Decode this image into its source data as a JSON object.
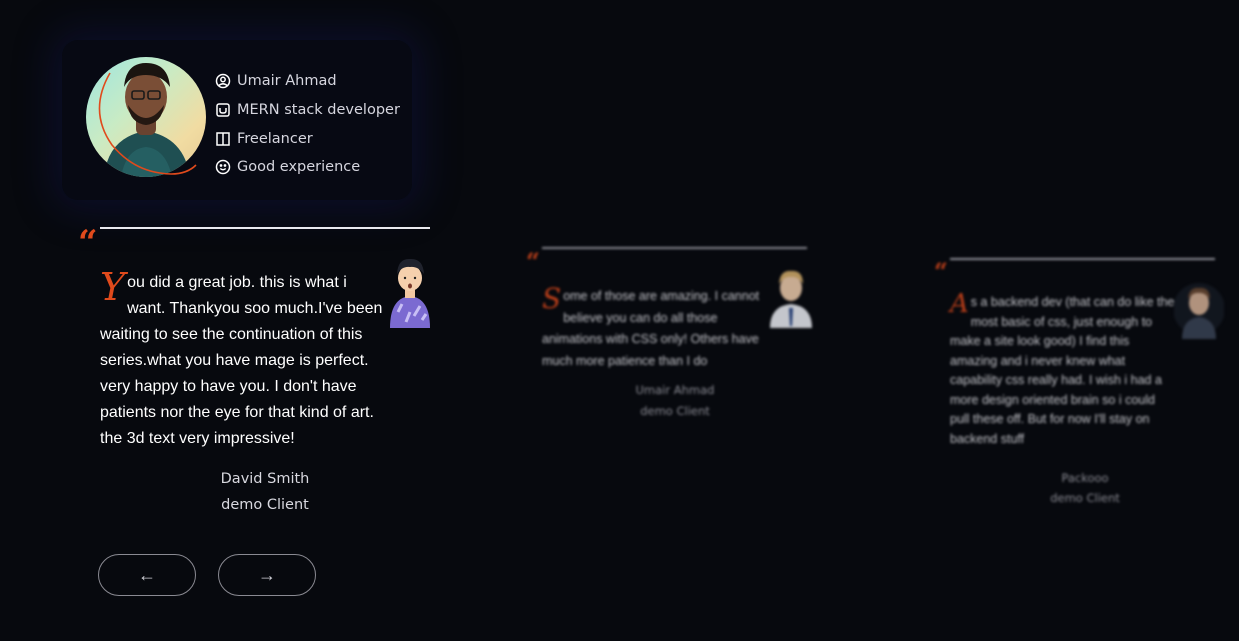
{
  "profile": {
    "name": "Umair Ahmad",
    "role": "MERN stack developer",
    "work": "Freelancer",
    "experience": "Good experience",
    "icons": [
      "user-circle-icon",
      "code-icon",
      "columns-icon",
      "smile-icon"
    ]
  },
  "testimonials": [
    {
      "dropcap": "Y",
      "text": "ou did a great job. this is what i want. Thankyou soo much.I've been waiting to see the continuation of this series.what you have mage is perfect. very happy to have you. I don't have patients nor the eye for that kind of art. the 3d text very impressive!",
      "name": "David Smith",
      "role": "demo Client"
    },
    {
      "dropcap": "S",
      "text": "ome of those are amazing. I cannot believe you can do all those animations with CSS only! Others have much more patience than I do",
      "name": "Umair Ahmad",
      "role": "demo Client"
    },
    {
      "dropcap": "A",
      "text": "s a backend dev (that can do like the most basic of css, just enough to make a site look good) I find this amazing and i never knew what capability css really had. I wish i had a more design oriented brain so i could pull these off. But for now I'll stay on backend stuff",
      "name": "Packooo",
      "role": "demo Client"
    }
  ],
  "nav": {
    "prev": "←",
    "next": "→"
  },
  "colors": {
    "accent": "#e04a1c",
    "background": "#07090e"
  }
}
